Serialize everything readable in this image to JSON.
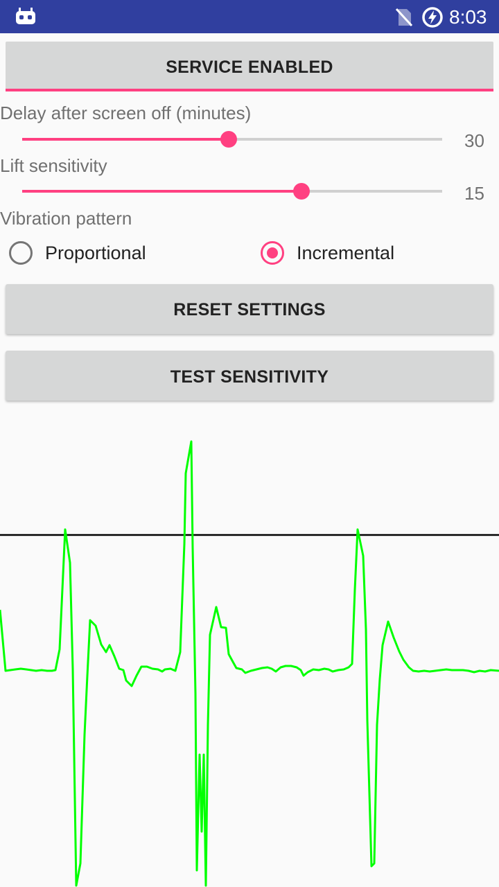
{
  "status_bar": {
    "time": "8:03",
    "icons": [
      "debug-android-icon",
      "no-sim-icon",
      "battery-charging-icon"
    ]
  },
  "service_button": {
    "label": "SERVICE ENABLED"
  },
  "delay": {
    "label": "Delay after screen off (minutes)",
    "value": "30",
    "fraction": 0.491
  },
  "lift": {
    "label": "Lift sensitivity",
    "value": "15",
    "fraction": 0.665
  },
  "vibration": {
    "label": "Vibration pattern",
    "options": [
      "Proportional",
      "Incremental"
    ],
    "selected": "Incremental"
  },
  "reset_button": {
    "label": "RESET SETTINGS"
  },
  "test_button": {
    "label": "TEST SENSITIVITY"
  },
  "colors": {
    "accent": "#ff4081",
    "status_bar": "#303f9f",
    "signal": "#00ff00",
    "threshold": "#000000"
  }
}
